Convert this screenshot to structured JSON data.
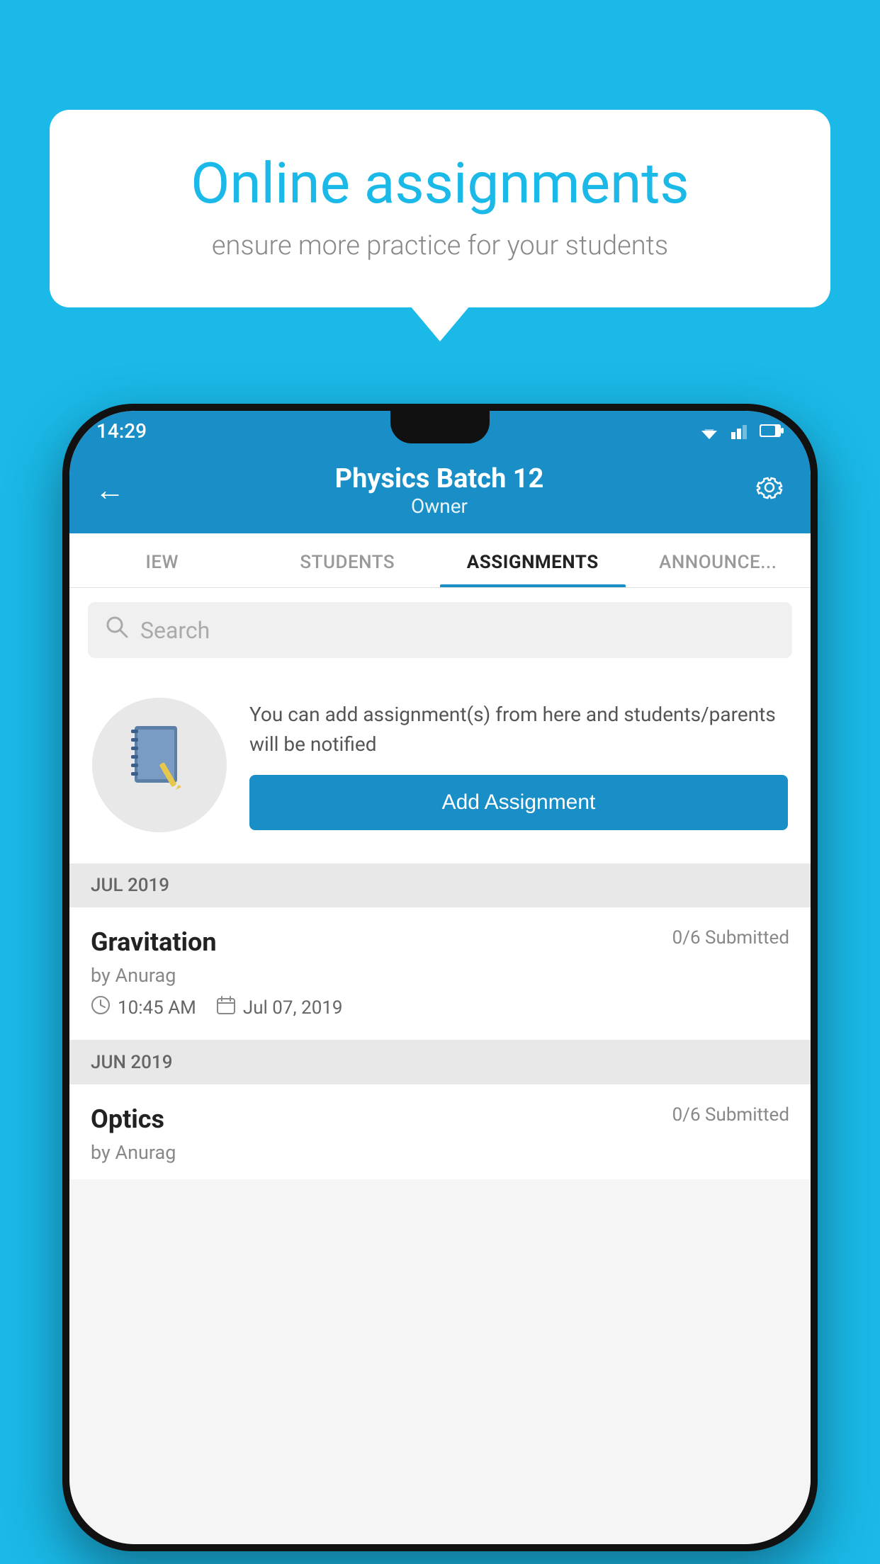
{
  "background_color": "#1ab9e8",
  "speech_bubble": {
    "title": "Online assignments",
    "subtitle": "ensure more practice for your students"
  },
  "status_bar": {
    "time": "14:29"
  },
  "app_header": {
    "title": "Physics Batch 12",
    "subtitle": "Owner"
  },
  "tabs": [
    {
      "label": "IEW",
      "active": false
    },
    {
      "label": "STUDENTS",
      "active": false
    },
    {
      "label": "ASSIGNMENTS",
      "active": true
    },
    {
      "label": "ANNOUNCEMENTS",
      "active": false
    }
  ],
  "search": {
    "placeholder": "Search"
  },
  "add_assignment_card": {
    "description": "You can add assignment(s) from here and students/parents will be notified",
    "button_label": "Add Assignment"
  },
  "sections": [
    {
      "label": "JUL 2019",
      "assignments": [
        {
          "name": "Gravitation",
          "submitted": "0/6 Submitted",
          "author": "by Anurag",
          "time": "10:45 AM",
          "date": "Jul 07, 2019"
        }
      ]
    },
    {
      "label": "JUN 2019",
      "assignments": [
        {
          "name": "Optics",
          "submitted": "0/6 Submitted",
          "author": "by Anurag",
          "time": "",
          "date": ""
        }
      ]
    }
  ]
}
